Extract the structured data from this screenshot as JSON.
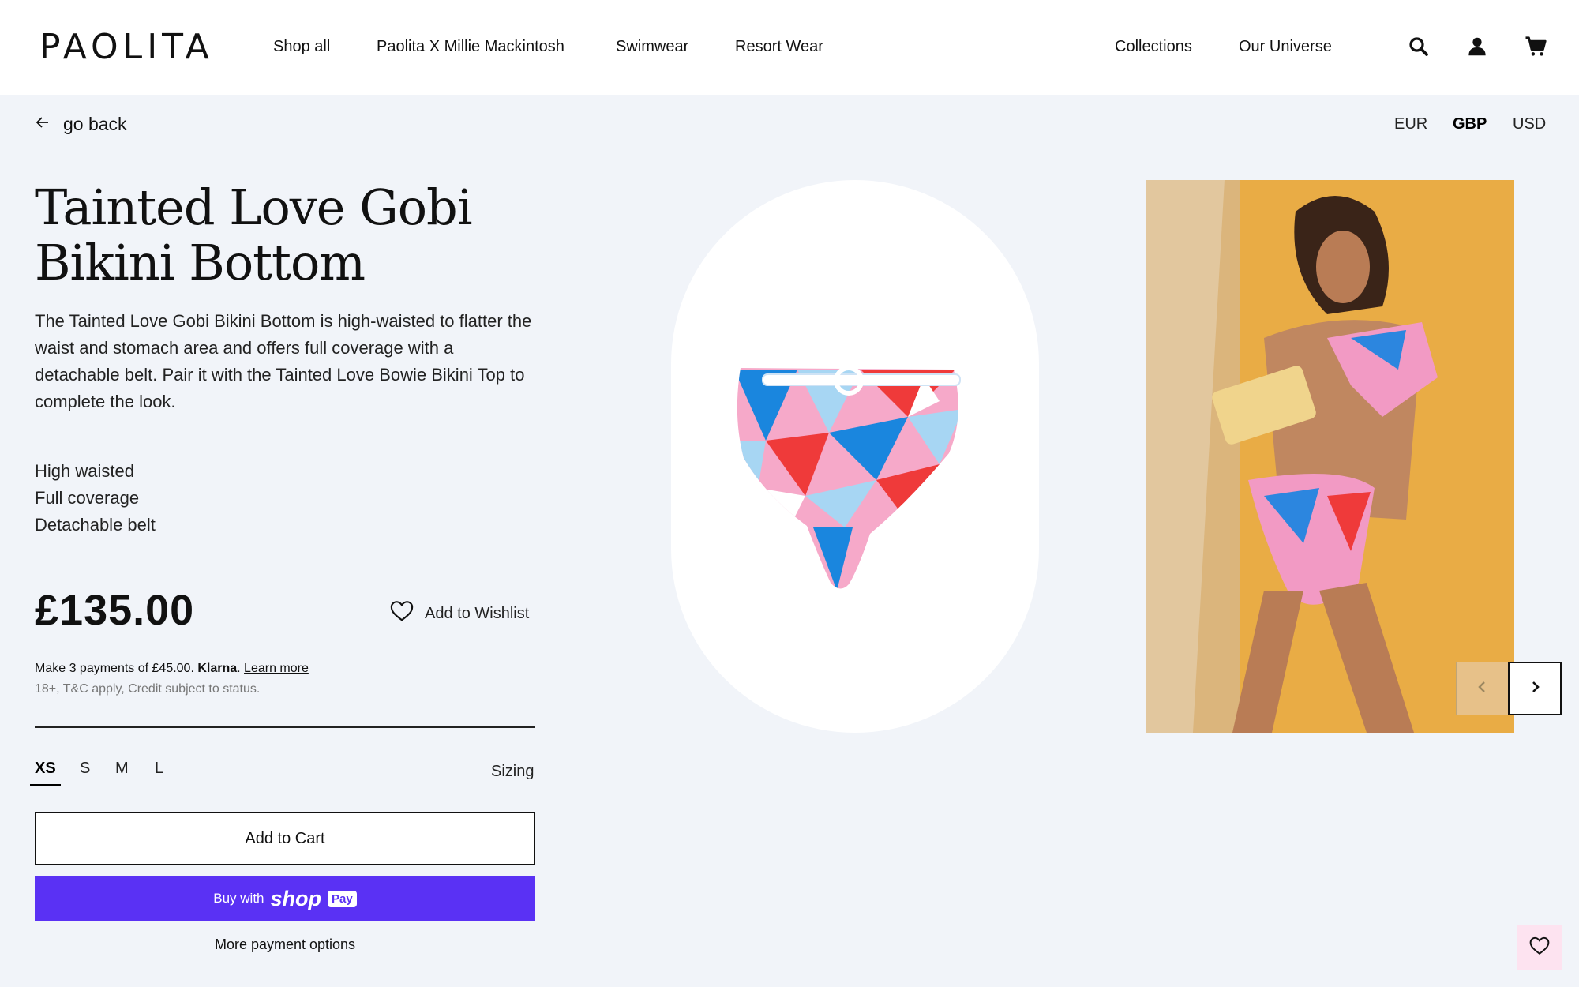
{
  "brand": {
    "logo": "PAOLITA"
  },
  "nav": {
    "left": [
      "Shop all",
      "Paolita X Millie Mackintosh",
      "Swimwear",
      "Resort Wear"
    ],
    "right": [
      "Collections",
      "Our Universe"
    ]
  },
  "icons": {
    "search": "search-icon",
    "account": "user-icon",
    "cart": "cart-icon"
  },
  "back": {
    "label": "go back"
  },
  "currencies": {
    "items": [
      "EUR",
      "GBP",
      "USD"
    ],
    "selected": "GBP"
  },
  "product": {
    "title_line1": "Tainted Love Gobi",
    "title_line2": "Bikini Bottom",
    "description": "The Tainted Love Gobi Bikini Bottom is high-waisted to flatter the waist and stomach area and offers full coverage with a detachable belt. Pair it with the Tainted Love Bowie Bikini Top to complete the look.",
    "features": [
      "High waisted",
      "Full coverage",
      "Detachable belt"
    ],
    "price": "£135.00",
    "wishlist_label": "Add to Wishlist",
    "klarna_text": "Make 3 payments of £45.00.",
    "klarna_brand": "Klarna",
    "klarna_link": "Learn more",
    "terms": "18+, T&C apply, Credit subject to status.",
    "sizes": [
      "XS",
      "S",
      "M",
      "L"
    ],
    "selected_size": "XS",
    "sizing_label": "Sizing",
    "add_to_cart": "Add to Cart",
    "shop_pay_prefix": "Buy with",
    "shop_pay_brand": "shop",
    "shop_pay_badge": "Pay",
    "more_payment": "More payment options"
  },
  "colors": {
    "accent_purple": "#5a31f4",
    "page_bg": "#f1f4f9",
    "photo_bg": "#e8a93e",
    "wish_bg": "#fde3f0"
  }
}
